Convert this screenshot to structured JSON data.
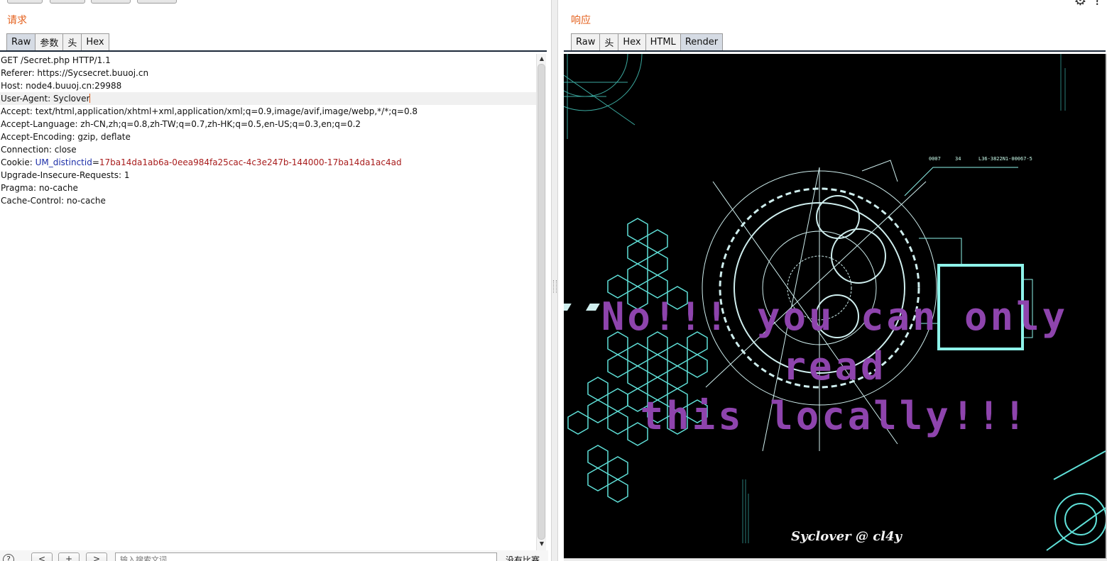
{
  "request": {
    "title": "请求",
    "tabs": [
      "Raw",
      "参数",
      "头",
      "Hex"
    ],
    "active_tab": "Raw",
    "lines": {
      "l0": "GET /Secret.php HTTP/1.1",
      "l1": "Referer: https://Sycsecret.buuoj.cn",
      "l2": "Host: node4.buuoj.cn:29988",
      "l3": "User-Agent: Syclover",
      "l4": "Accept: text/html,application/xhtml+xml,application/xml;q=0.9,image/avif,image/webp,*/*;q=0.8",
      "l5": "Accept-Language: zh-CN,zh;q=0.8,zh-TW;q=0.7,zh-HK;q=0.5,en-US;q=0.3,en;q=0.2",
      "l6": "Accept-Encoding: gzip, deflate",
      "l7": "Connection: close",
      "l8_prefix": "Cookie: ",
      "l8_name": "UM_distinctid",
      "l8_eq": "=",
      "l8_value": "17ba14da1ab6a-0eea984fa25cac-4c3e247b-144000-17ba14da1ac4ad",
      "l9": "Upgrade-Insecure-Requests: 1",
      "l10": "Pragma: no-cache",
      "l11": "Cache-Control: no-cache"
    }
  },
  "search": {
    "help": "?",
    "prev": "<",
    "add": "+",
    "next": ">",
    "placeholder": "输入搜索文词",
    "status": "没有比赛"
  },
  "response": {
    "title": "响应",
    "tabs": [
      "Raw",
      "头",
      "Hex",
      "HTML",
      "Render"
    ],
    "active_tab": "Render",
    "render": {
      "message_line1": "No!!! you can only read",
      "message_line2": "this locally!!!",
      "signature": "Syclover @ cl4y",
      "hud_a": "0007",
      "hud_b": "34",
      "hud_c": "L36-3822N1-00067-5"
    }
  },
  "colors": {
    "title_orange": "#e4601c",
    "message_purple": "#8e44ad",
    "hud_cyan": "#5fe0d8",
    "cookie_name_blue": "#1c2ea8",
    "cookie_value_red": "#a81c1c"
  }
}
